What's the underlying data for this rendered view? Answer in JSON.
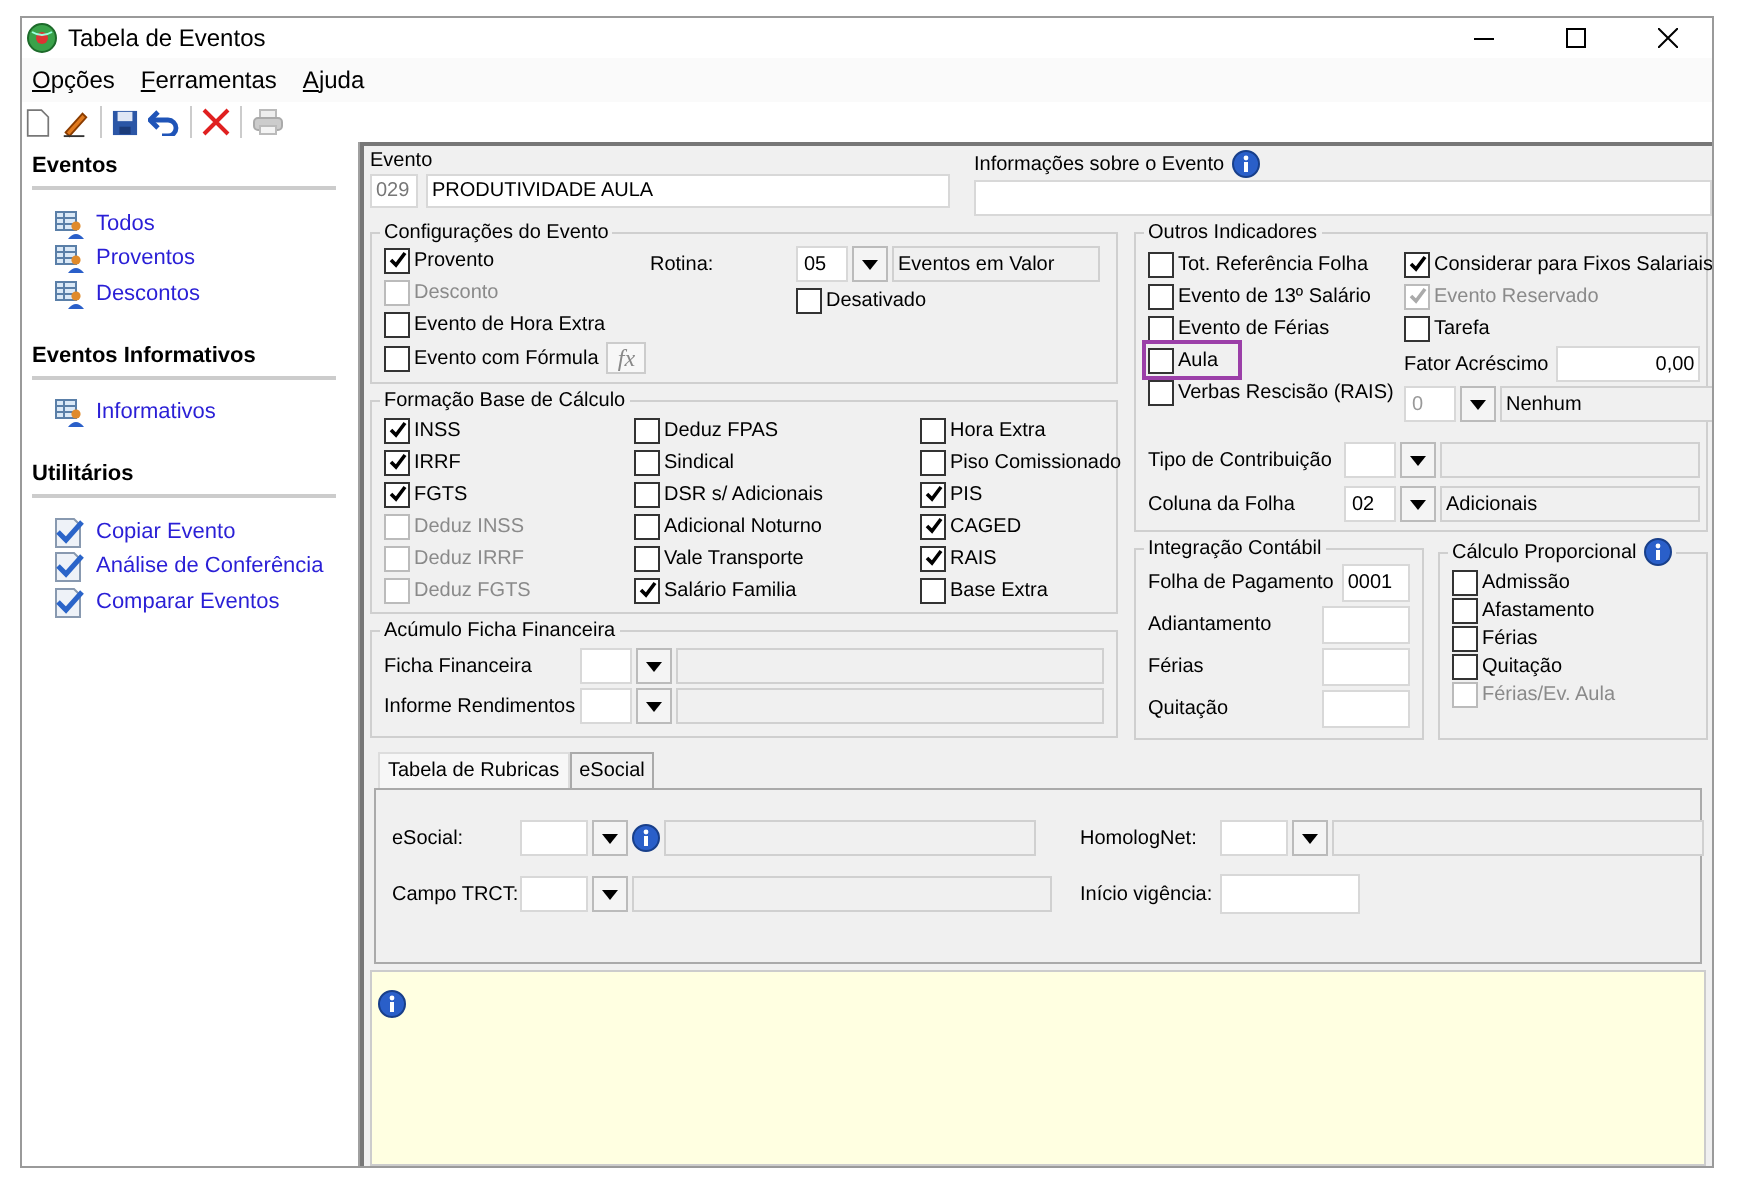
{
  "window": {
    "title": "Tabela de Eventos"
  },
  "menu": [
    {
      "label": "Opções"
    },
    {
      "label": "Ferramentas"
    },
    {
      "label": "Ajuda"
    }
  ],
  "sidebar": [
    {
      "title": "Eventos",
      "kind": "list",
      "items": [
        {
          "label": "Todos"
        },
        {
          "label": "Proventos"
        },
        {
          "label": "Descontos"
        }
      ]
    },
    {
      "title": "Eventos Informativos",
      "kind": "list",
      "items": [
        {
          "label": "Informativos"
        }
      ]
    },
    {
      "title": "Utilitários",
      "kind": "tool",
      "items": [
        {
          "label": "Copiar Evento"
        },
        {
          "label": "Análise de Conferência"
        },
        {
          "label": "Comparar Eventos"
        }
      ]
    }
  ],
  "evento": {
    "label": "Evento",
    "code": "029",
    "name": "PRODUTIVIDADE AULA"
  },
  "info_evento": {
    "label": "Informações sobre o Evento"
  },
  "config": {
    "title": "Configurações do Evento",
    "checkboxes": [
      {
        "label": "Provento",
        "checked": true,
        "disabled": false
      },
      {
        "label": "Desconto",
        "checked": false,
        "disabled": true
      },
      {
        "label": "Evento de Hora Extra",
        "checked": false,
        "disabled": false
      },
      {
        "label": "Evento com Fórmula",
        "checked": false,
        "disabled": false
      }
    ],
    "formula_button": "fx",
    "rotina": {
      "label": "Rotina:",
      "code": "05",
      "description": "Eventos em Valor"
    },
    "desativado": {
      "label": "Desativado",
      "checked": false
    }
  },
  "formacao": {
    "title": "Formação Base de Cálculo",
    "columns": [
      [
        {
          "label": "INSS",
          "checked": true,
          "disabled": false
        },
        {
          "label": "IRRF",
          "checked": true,
          "disabled": false
        },
        {
          "label": "FGTS",
          "checked": true,
          "disabled": false
        },
        {
          "label": "Deduz INSS",
          "checked": false,
          "disabled": true
        },
        {
          "label": "Deduz IRRF",
          "checked": false,
          "disabled": true
        },
        {
          "label": "Deduz FGTS",
          "checked": false,
          "disabled": true
        }
      ],
      [
        {
          "label": "Deduz FPAS",
          "checked": false,
          "disabled": false
        },
        {
          "label": "Sindical",
          "checked": false,
          "disabled": false
        },
        {
          "label": "DSR s/ Adicionais",
          "checked": false,
          "disabled": false
        },
        {
          "label": "Adicional Noturno",
          "checked": false,
          "disabled": false
        },
        {
          "label": "Vale Transporte",
          "checked": false,
          "disabled": false
        },
        {
          "label": "Salário Familia",
          "checked": true,
          "disabled": false
        }
      ],
      [
        {
          "label": "Hora Extra",
          "checked": false,
          "disabled": false
        },
        {
          "label": "Piso Comissionado",
          "checked": false,
          "disabled": false
        },
        {
          "label": "PIS",
          "checked": true,
          "disabled": false
        },
        {
          "label": "CAGED",
          "checked": true,
          "disabled": false
        },
        {
          "label": "RAIS",
          "checked": true,
          "disabled": false
        },
        {
          "label": "Base Extra",
          "checked": false,
          "disabled": false
        }
      ]
    ]
  },
  "acumulo": {
    "title": "Acúmulo Ficha Financeira",
    "rows": [
      {
        "label": "Ficha Financeira"
      },
      {
        "label": "Informe Rendimentos"
      }
    ]
  },
  "outros": {
    "title": "Outros Indicadores",
    "left": [
      {
        "label": "Tot. Referência Folha",
        "checked": false,
        "highlighted": false
      },
      {
        "label": "Evento de 13º Salário",
        "checked": false,
        "highlighted": false
      },
      {
        "label": "Evento de Férias",
        "checked": false,
        "highlighted": false
      },
      {
        "label": "Aula",
        "checked": false,
        "highlighted": true
      },
      {
        "label": "Verbas Rescisão (RAIS)",
        "checked": false,
        "highlighted": false
      }
    ],
    "right": [
      {
        "label": "Considerar para Fixos Salariais",
        "checked": true,
        "disabled": false
      },
      {
        "label": "Evento Reservado",
        "checked": true,
        "disabled": true
      },
      {
        "label": "Tarefa",
        "checked": false,
        "disabled": false
      }
    ],
    "fator": {
      "label": "Fator Acréscimo",
      "value": "0,00"
    },
    "rais_combo": {
      "code": "0",
      "description": "Nenhum",
      "disabled": true
    },
    "selects": [
      {
        "label": "Tipo de Contribuição"
      },
      {
        "label": "Coluna da Folha",
        "code": "02",
        "description": "Adicionais"
      }
    ]
  },
  "integracao": {
    "title": "Integração Contábil",
    "rows": [
      {
        "label": "Folha de Pagamento",
        "value": "0001"
      },
      {
        "label": "Adiantamento"
      },
      {
        "label": "Férias"
      },
      {
        "label": "Quitação"
      }
    ]
  },
  "calculo": {
    "title": "Cálculo Proporcional",
    "checkboxes": [
      {
        "label": "Admissão",
        "checked": false,
        "disabled": false
      },
      {
        "label": "Afastamento",
        "checked": false,
        "disabled": false
      },
      {
        "label": "Férias",
        "checked": false,
        "disabled": false
      },
      {
        "label": "Quitação",
        "checked": false,
        "disabled": false
      },
      {
        "label": "Férias/Ev. Aula",
        "checked": false,
        "disabled": true
      }
    ]
  },
  "tabs": [
    {
      "label": "Tabela de Rubricas",
      "selected": true
    },
    {
      "label": "eSocial",
      "selected": false
    }
  ],
  "rubricas": {
    "left": [
      {
        "label": "eSocial:",
        "info": true
      },
      {
        "label": "Campo TRCT:",
        "info": false
      }
    ],
    "right": [
      {
        "label": "HomologNet:",
        "kind": "combo"
      },
      {
        "label": "Início vigência:",
        "kind": "date"
      }
    ]
  }
}
